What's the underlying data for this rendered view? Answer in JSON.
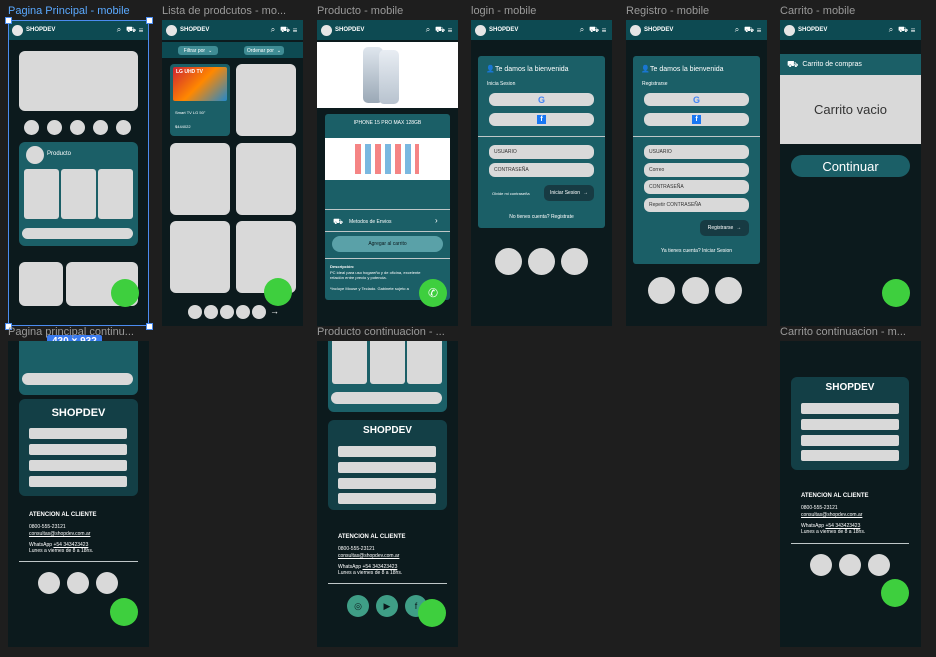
{
  "frames": {
    "home": "Pagina Principal - mobile",
    "list": "Lista de prodcutos - mo...",
    "product": "Producto - mobile",
    "login": "login - mobile",
    "register": "Registro - mobile",
    "cart": "Carrito - mobile",
    "home_cont": "Pagina principal continu...",
    "product_cont": "Producto continuacion - ...",
    "cart_cont": "Carrito continuacion - m..."
  },
  "selection_size": "430 × 932",
  "brand": "SHOPDEV",
  "icons": {
    "search": "search-icon",
    "cart": "cart-icon",
    "menu": "menu-icon"
  },
  "home": {
    "product_label": "Producto"
  },
  "list": {
    "filter": "Filtrar por",
    "order": "Ordenar por",
    "product_name": "Smart TV LG 50\"",
    "product_price": "$444022",
    "tv_brand": "LG UHD TV"
  },
  "product": {
    "title": "IPHONE 15 PRO MAX 128GB",
    "shipping": "Metodos de Envios",
    "add_cart": "Agregar al carrito",
    "desc_title": "Descripción:",
    "desc_line1": "PC ideal para uso hogareño y de oficina, excelente",
    "desc_line2": "relación entre precio y potencia.",
    "desc_line3": "*Incluye Mouse y Teclado. Gabinete sujeto a"
  },
  "login": {
    "welcome": "Te damos la bienvenida",
    "subtitle": "Inicia Sesion",
    "user": "USUARIO",
    "pass": "CONTRASEÑA",
    "forgot": "Olvide mi contraseña",
    "submit": "Iniciar Sesion",
    "no_account": "No tienes cuenta? Registrate"
  },
  "register": {
    "welcome": "Te damos la bienvenida",
    "subtitle": "Registrarse",
    "user": "USUARIO",
    "email": "Correo",
    "pass": "CONTRASEÑA",
    "repeat": "Repetir CONTRASEÑA",
    "submit": "Registrarse",
    "have_account": "Ya tienes cuenta? Iniciar Sesion"
  },
  "cart": {
    "header": "Carrito de compras",
    "empty": "Carrito vacio",
    "continue": "Continuar"
  },
  "footer": {
    "title": "ATENCION AL CLIENTE",
    "phone": "0800-555-23121",
    "email": "consultas@shopdev.com.ar",
    "whatsapp_prefix": "WhatsApp",
    "whatsapp": "+54 343423423",
    "hours": "Lunes a viernes de 8 a 18hs."
  }
}
